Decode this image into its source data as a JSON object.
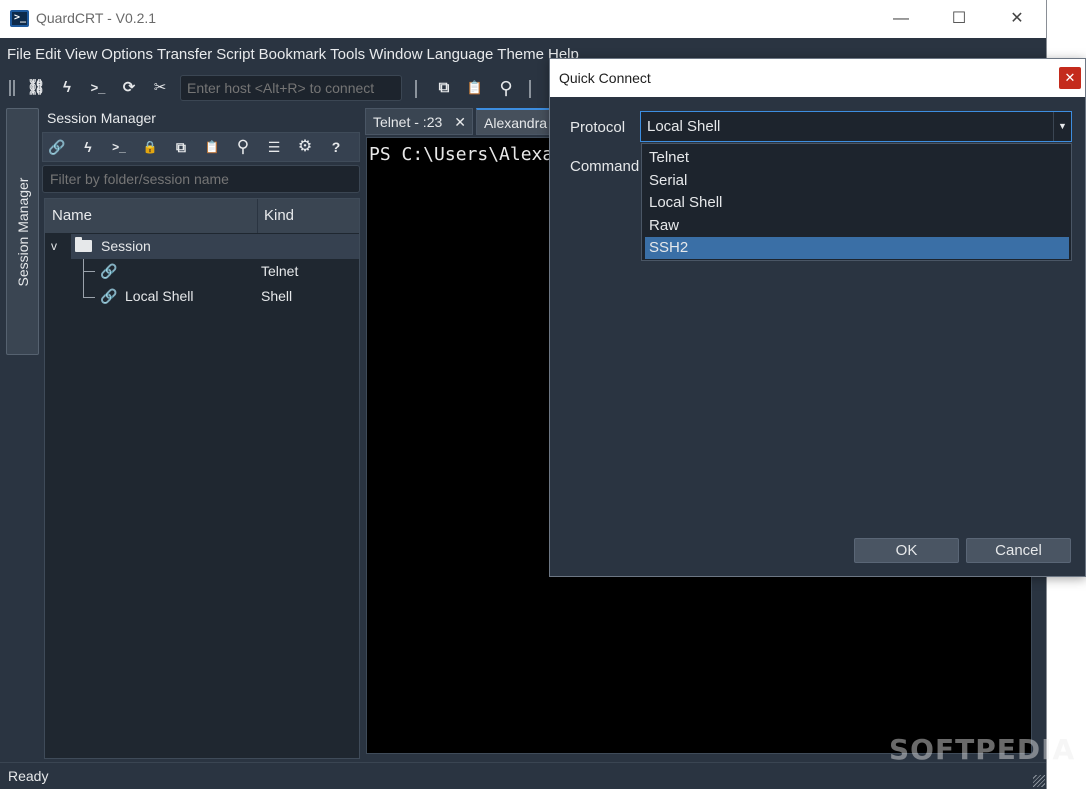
{
  "window": {
    "title": "QuardCRT - V0.2.1",
    "minimize": "—",
    "maximize": "☐",
    "close": "✕",
    "icon_glyph": ">_"
  },
  "menu": [
    "File",
    "Edit",
    "View",
    "Options",
    "Transfer",
    "Script",
    "Bookmark",
    "Tools",
    "Window",
    "Language",
    "Theme",
    "Help"
  ],
  "toolbar": {
    "host_placeholder": "Enter host <Alt+R> to connect",
    "icons": [
      "sitemap-icon",
      "bolt-icon",
      "terminal-prompt-icon",
      "refresh-icon",
      "disconnect-icon",
      "copy-icon",
      "paste-icon",
      "search-icon"
    ],
    "glyphs": {
      "sitemap": "⛓",
      "bolt": "ϟ",
      "prompt": ">_",
      "refresh": "⟳",
      "disconnect": "✂",
      "copy": "⧉",
      "paste": "📋",
      "search": "⚲"
    }
  },
  "side_tab": {
    "label": "Session Manager"
  },
  "session_manager": {
    "title": "Session Manager",
    "filter_placeholder": "Filter by folder/session name",
    "tools": {
      "link": "🔗",
      "bolt": "ϟ",
      "prompt": ">_",
      "lock": "🔒",
      "copy": "⧉",
      "paste": "📋",
      "search": "⚲",
      "sliders": "☰",
      "gear": "⚙",
      "help": "?"
    },
    "columns": {
      "name": "Name",
      "kind": "Kind"
    },
    "tree": {
      "folder": {
        "name": "Session",
        "chevron": "v"
      },
      "items": [
        {
          "name": "",
          "kind": "Telnet"
        },
        {
          "name": "Local Shell",
          "kind": "Shell"
        }
      ]
    }
  },
  "tabs": [
    {
      "label": "Telnet - :23",
      "close": "✕"
    },
    {
      "label": "Alexandra"
    }
  ],
  "terminal": {
    "text": "PS C:\\Users\\Alexand"
  },
  "status": {
    "text": "Ready"
  },
  "dialog": {
    "title": "Quick Connect",
    "close": "✕",
    "protocol_label": "Protocol",
    "command_label": "Command",
    "protocol_value": "Local Shell",
    "dropdown_arrow": "▼",
    "options": [
      "Telnet",
      "Serial",
      "Local Shell",
      "Raw",
      "SSH2"
    ],
    "highlighted_option": "SSH2",
    "ok_label": "OK",
    "cancel_label": "Cancel"
  },
  "watermark": "SOFTPEDIA",
  "colors": {
    "background": "#2a3441",
    "accent": "#3d8ee0",
    "selection": "#3a6fa6",
    "close_red": "#c42b1c"
  }
}
